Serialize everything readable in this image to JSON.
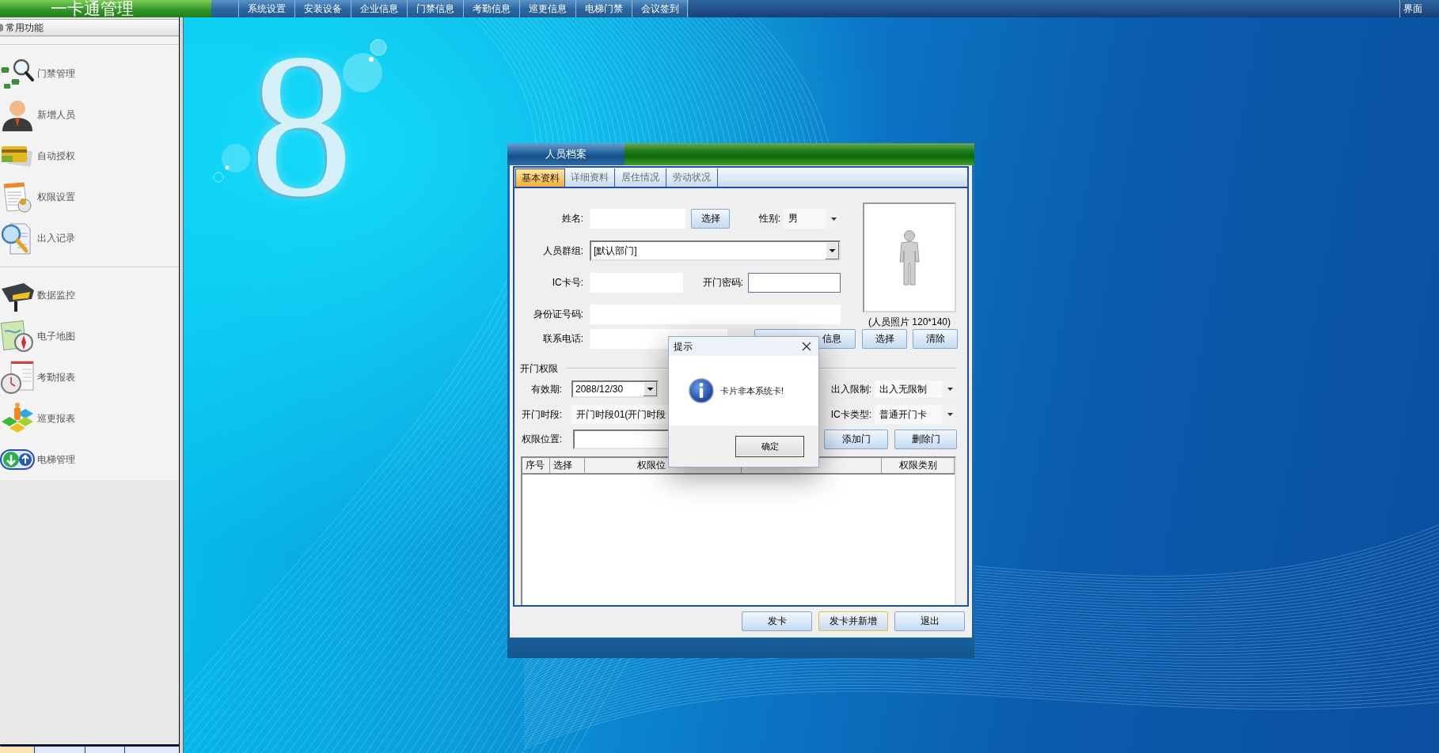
{
  "top_bar": {
    "title": "一卡通管理",
    "menu": [
      "系统设置",
      "安装设备",
      "企业信息",
      "门禁信息",
      "考勤信息",
      "巡更信息",
      "电梯门禁",
      "会议签到"
    ],
    "right_button": "界面"
  },
  "sidebar": {
    "header": "常用功能",
    "groups": [
      {
        "items": [
          "门禁管理",
          "新增人员",
          "自动授权",
          "权限设置",
          "出入记录"
        ]
      },
      {
        "items": [
          "数据监控",
          "电子地图",
          "考勤报表",
          "巡更报表",
          "电梯管理"
        ]
      }
    ],
    "bottom_tabs": [
      {
        "selected": true
      },
      {
        "selected": false
      },
      {
        "selected": false
      },
      {
        "selected": false
      }
    ]
  },
  "desktop": {
    "logo": "8"
  },
  "person_dialog": {
    "title": "人员档案",
    "tabs": [
      {
        "label": "基本资料",
        "selected": true
      },
      {
        "label": "详细资料",
        "selected": false
      },
      {
        "label": "居住情况",
        "selected": false
      },
      {
        "label": "劳动状况",
        "selected": false
      }
    ],
    "basic": {
      "name": {
        "label": "姓名:",
        "button": "选择"
      },
      "gender": {
        "label": "性别:",
        "value": "男"
      },
      "group": {
        "label": "人员群组:",
        "value": "[默认部门]"
      },
      "ic_card": {
        "label": "IC卡号:"
      },
      "door_password": {
        "label": "开门密码:"
      },
      "id_number": {
        "label": "身份证号码:"
      },
      "phone": {
        "label": "联系电话:"
      },
      "id_card_button": "信息",
      "photo": {
        "caption": "(人员照片 120*140)",
        "buttons": [
          "选择",
          "清除"
        ]
      }
    },
    "access": {
      "title": "开门权限",
      "validity": {
        "label": "有效期:",
        "value": "2088/12/30"
      },
      "in_out_limit": {
        "label": "出入限制:",
        "value": "出入无限制"
      },
      "time_slot": {
        "label": "开门时段:",
        "value": "开门时段01(开门时段"
      },
      "card_type": {
        "label": "IC卡类型:",
        "value": "普通开门卡"
      },
      "location": {
        "label": "权限位置:"
      },
      "buttons": [
        "添加门",
        "删除门"
      ],
      "table": {
        "columns": [
          {
            "label": "序号"
          },
          {
            "label": "选择"
          },
          {
            "label": "权限位"
          },
          {},
          {
            "label": "权限类别"
          }
        ]
      }
    },
    "buttons": [
      {
        "label": "发卡",
        "focused": false
      },
      {
        "label": "发卡并新增",
        "focused": true
      },
      {
        "label": "退出",
        "focused": false
      }
    ]
  },
  "alert": {
    "title": "提示",
    "message": "卡片非本系统卡!",
    "button": "确定"
  }
}
